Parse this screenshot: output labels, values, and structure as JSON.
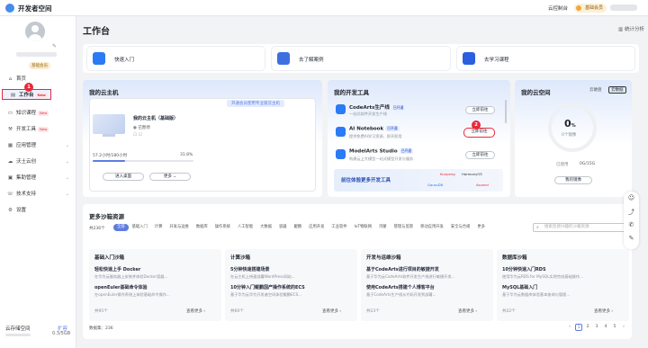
{
  "topbar": {
    "brand": "开发者空间",
    "console": "云控制台",
    "vip_label": "基础会员"
  },
  "sidebar": {
    "level_badge": "基础会员",
    "items": [
      {
        "icon": "home-icon",
        "label": "首页",
        "tag": ""
      },
      {
        "icon": "desk-icon",
        "label": "工作台",
        "tag": "New"
      },
      {
        "icon": "book-icon",
        "label": "知识课程",
        "tag": "New"
      },
      {
        "icon": "tool-icon",
        "label": "开发工具",
        "tag": "New"
      },
      {
        "icon": "app-icon",
        "label": "应用管理",
        "tag": ""
      },
      {
        "icon": "cloud-icon",
        "label": "沃土云创",
        "tag": ""
      },
      {
        "icon": "shop-icon",
        "label": "集助管理",
        "tag": ""
      },
      {
        "icon": "support-icon",
        "label": "技术支持",
        "tag": ""
      },
      {
        "icon": "settings-icon",
        "label": "设置",
        "tag": ""
      }
    ],
    "storage_label": "云存储空间",
    "storage_btn": "扩容",
    "storage_value": "0.3/5GB"
  },
  "main": {
    "title": "工作台",
    "stats": "统计分析",
    "quick": [
      "快速入门",
      "去了解案例",
      "去学习课程"
    ],
    "host": {
      "title": "我的云主机",
      "banner": "开通会员使用专业版云主机",
      "name": "我的云主机（基础版）",
      "status": "已暂停",
      "spec": "57.2小时/180小时",
      "percent": "31.8%",
      "btn_desktop": "进入桌面",
      "btn_more": "更多"
    },
    "tools": {
      "title": "我的开发工具",
      "items": [
        {
          "name": "CodeArts生产线",
          "tag": "已开通",
          "desc": "一站式软件开发生产线",
          "btn": "立即前往"
        },
        {
          "name": "AI Notebook",
          "tag": "已开通",
          "desc": "提供免费AI学习资源，即开即用",
          "btn": "立即前往"
        },
        {
          "name": "ModelArts Studio",
          "tag": "已开通",
          "desc": "构建云上大模型一站式模型开发与服务",
          "btn": "立即前往"
        }
      ],
      "promo": "前往体验更多开发工具",
      "partners": [
        "Kunpeng",
        "HarmonyOS",
        "GaussDB",
        "Ascend"
      ]
    },
    "cloud": {
      "title": "我的云空间",
      "tab1": "云硬盘",
      "tab2": "云数据",
      "percent": "0",
      "unit": "%",
      "count": "0个镜像",
      "used_label": "已使用",
      "used_value": "0G/15G",
      "btn": "我的镜像"
    },
    "sandbox": {
      "title": "更多沙箱资源",
      "count": "共236个",
      "row1": [
        "全部",
        "基础入门",
        "计算",
        "开发与运维",
        "数据库",
        "操作系统",
        "人工智能",
        "大数据",
        "容器",
        "鲲鹏",
        "应用开发",
        "工业软件",
        "IoT物联网",
        "鸿蒙",
        "管理与监管",
        "移动应用开发"
      ],
      "row2": [
        "安全与合规",
        "更多"
      ],
      "search_placeholder": "搜索您感兴趣的沙箱资源",
      "cols": [
        {
          "title": "基础入门沙箱",
          "items": [
            {
              "t": "轻松快速上手 Docker",
              "d": "在华为云服务器上安装并体验Docker容器..."
            },
            {
              "t": "openEuler基础命令体验",
              "d": "在openEuler操作系统上体验基础命令操作..."
            }
          ],
          "count": "共95个",
          "more": "查看更多"
        },
        {
          "title": "计算沙箱",
          "items": [
            {
              "t": "5分钟快速搭建场景",
              "d": "在云主机上快速部署WordPress网站..."
            },
            {
              "t": "10分钟入门鲲鹏国产操作系统的ECS",
              "d": "基于华为云华为开发者空间体验鲲鹏ECS..."
            }
          ],
          "count": "共60个",
          "more": "查看更多"
        },
        {
          "title": "开发与运维沙箱",
          "items": [
            {
              "t": "基于CodeArts进行项目的敏捷开发",
              "d": "基于华为云CodeArts软件开发生产线进行敏捷开发..."
            },
            {
              "t": "使用CodeArts搭建个人博客平台",
              "d": "基于CodeArts生产线从代码开发到部署..."
            }
          ],
          "count": "共23个",
          "more": "查看更多"
        },
        {
          "title": "数据库沙箱",
          "items": [
            {
              "t": "10分钟快速入门RDS",
              "d": "使用华为云RDS for MySQL实例完成基础操作..."
            },
            {
              "t": "MySQL基础入门",
              "d": "基于华为云数据库体验基本查询与管理..."
            }
          ],
          "count": "共22个",
          "more": "查看更多"
        }
      ],
      "total": "数据集：236",
      "pages": [
        "1",
        "2",
        "3",
        "4",
        "5"
      ]
    }
  },
  "colors": {
    "accent": "#5e7ce0",
    "highlight": "#e8293b"
  }
}
